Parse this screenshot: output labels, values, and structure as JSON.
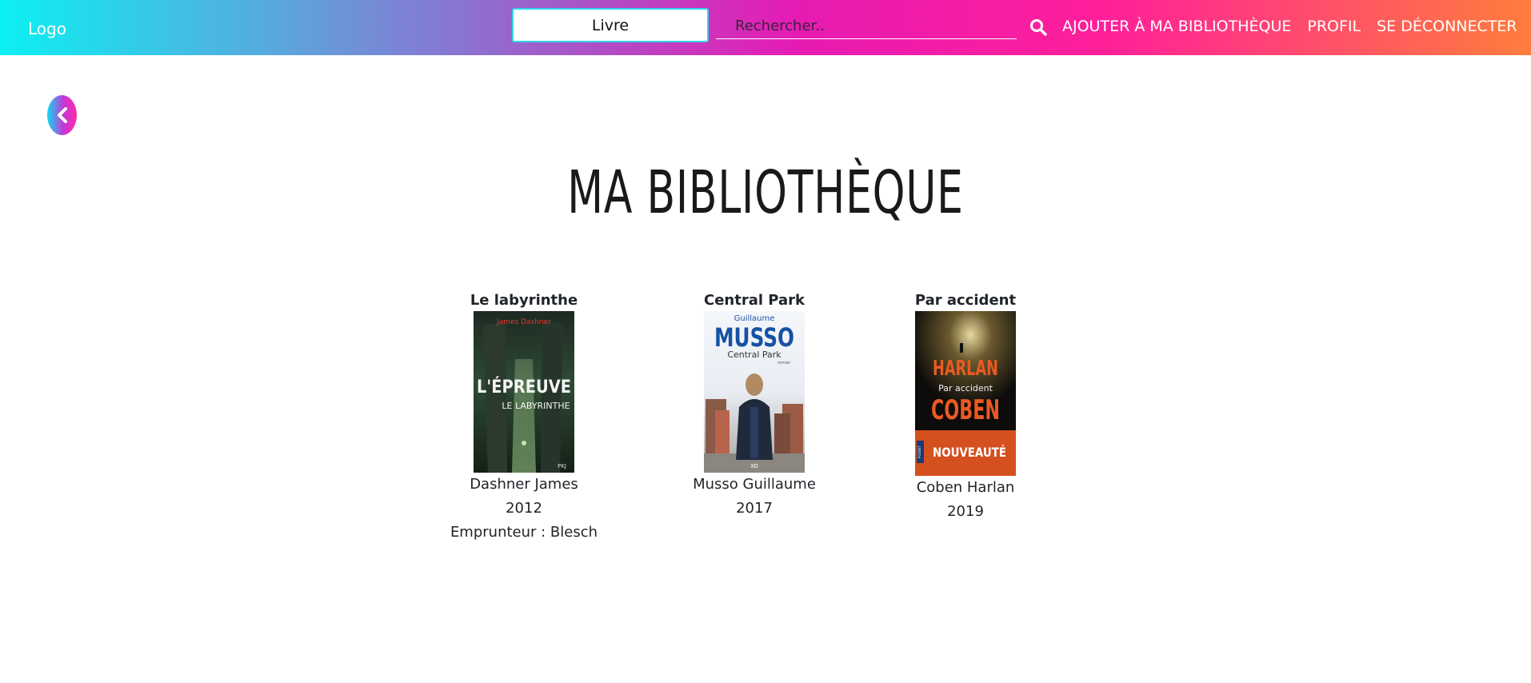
{
  "navbar": {
    "logo": "Logo",
    "type_select": "Livre",
    "search_placeholder": "Rechercher..",
    "links": [
      "AJOUTER À MA BIBLIOTHÈQUE",
      "PROFIL",
      "SE DÉCONNECTER"
    ]
  },
  "page": {
    "title": "MA BIBLIOTHÈQUE"
  },
  "books": [
    {
      "title": "Le labyrinthe",
      "author": "Dashner James",
      "year": "2012",
      "borrower": "Emprunteur : Blesch",
      "cover": {
        "author": "James Dashner",
        "line1": "L'ÉPREUVE",
        "line2": "LE LABYRINTHE",
        "publisher": "PKJ"
      }
    },
    {
      "title": "Central Park",
      "author": "Musso Guillaume",
      "year": "2017",
      "cover": {
        "first": "Guillaume",
        "last": "MUSSO",
        "subtitle": "Central Park",
        "tag": "roman",
        "publisher": "XO"
      }
    },
    {
      "title": "Par accident",
      "author": "Coben Harlan",
      "year": "2019",
      "cover": {
        "first": "HARLAN",
        "subtitle": "Par accident",
        "last": "COBEN",
        "badge": "NOUVEAUTÉ",
        "publisher": "POCKET"
      }
    }
  ],
  "icons": {
    "search": "search-icon",
    "back": "chevron-left-icon"
  }
}
